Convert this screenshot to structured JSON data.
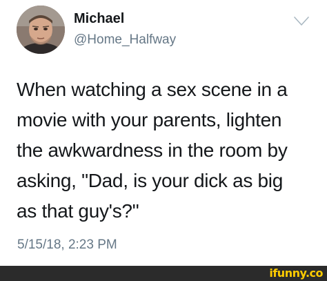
{
  "tweet": {
    "display_name": "Michael",
    "handle": "@Home_Halfway",
    "text_lines": [
      "When watching a sex scene in a",
      "movie with your parents, lighten",
      "the awkwardness in the room by",
      "asking, \"Dad, is your dick as big",
      "as that guy's?\""
    ],
    "timestamp": "5/15/18, 2:23 PM",
    "menu_icon": "chevron-down-icon",
    "avatar_icon": "avatar"
  },
  "footer": {
    "watermark": "ifunny.co"
  },
  "colors": {
    "text": "#14171a",
    "secondary_text": "#657786",
    "footer_bg": "#2b2b2b",
    "watermark": "#ffcc00"
  }
}
